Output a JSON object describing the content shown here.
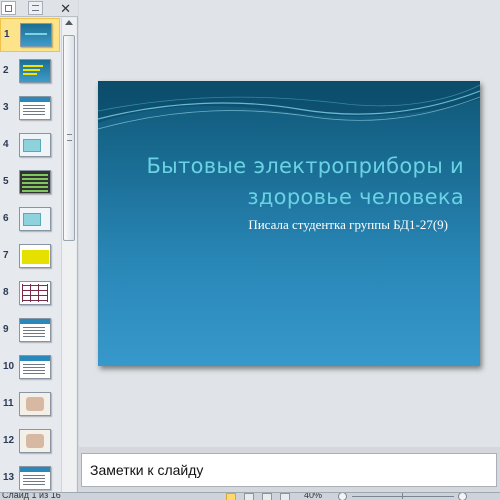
{
  "left_pane": {
    "close_glyph": "✕",
    "slides": [
      {
        "number": "1",
        "style": "blue",
        "selected": true
      },
      {
        "number": "2",
        "style": "yellowlines"
      },
      {
        "number": "3",
        "style": "white"
      },
      {
        "number": "4",
        "style": "pic"
      },
      {
        "number": "5",
        "style": "table"
      },
      {
        "number": "6",
        "style": "pic"
      },
      {
        "number": "7",
        "style": "yellow"
      },
      {
        "number": "8",
        "style": "grid"
      },
      {
        "number": "9",
        "style": "white"
      },
      {
        "number": "10",
        "style": "white"
      },
      {
        "number": "11",
        "style": "photo"
      },
      {
        "number": "12",
        "style": "photo"
      },
      {
        "number": "13",
        "style": "white"
      }
    ]
  },
  "slide": {
    "title_line1": "Бытовые электроприборы и",
    "title_line2": "здоровье человека",
    "subtitle": "Писала студентка группы БД1-27(9)"
  },
  "notes": {
    "placeholder": "Заметки к слайду"
  },
  "status": {
    "slide_info": "Слайд 1 из 16",
    "zoom": "40%"
  },
  "colors": {
    "title": "#6ad3e3",
    "slide_dark": "#0f5676",
    "slide_light": "#3798cb",
    "selection": "#fde38a"
  }
}
